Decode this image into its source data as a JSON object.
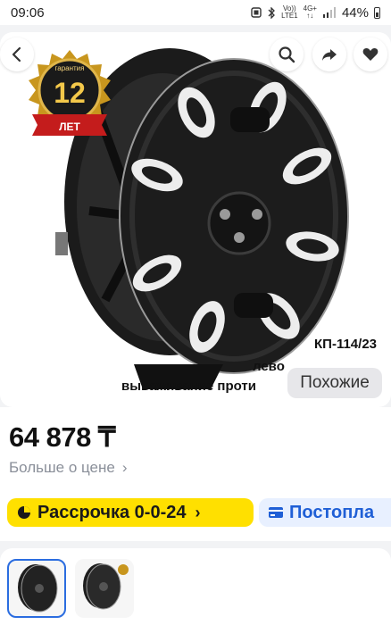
{
  "status_bar": {
    "time": "09:06",
    "network_top": "Vo))",
    "network_bottom": "LTE1",
    "network2_top": "4G+",
    "battery": "44%"
  },
  "gallery": {
    "badge": {
      "top_text": "гарантия",
      "number": "12",
      "ribbon_text": "ЛЕТ"
    },
    "caption_model": "КП-114/23",
    "caption_line1": "лево",
    "caption_line2": "вываживание проти",
    "similar_label": "Похожие",
    "icons": [
      "back-icon",
      "search-icon",
      "share-icon",
      "favorite-icon"
    ]
  },
  "price_block": {
    "price": "64 878 ₸",
    "more_price_label": "Больше о цене",
    "more_price_chevron": "›"
  },
  "chips": {
    "installment_label": "Рассрочка 0-0-24",
    "installment_chevron": "›",
    "postpay_label": "Постопла"
  },
  "colors": {
    "accent_yellow": "#ffe000",
    "accent_blue": "#1f5fd6",
    "thumb_active_border": "#2b6de0"
  }
}
